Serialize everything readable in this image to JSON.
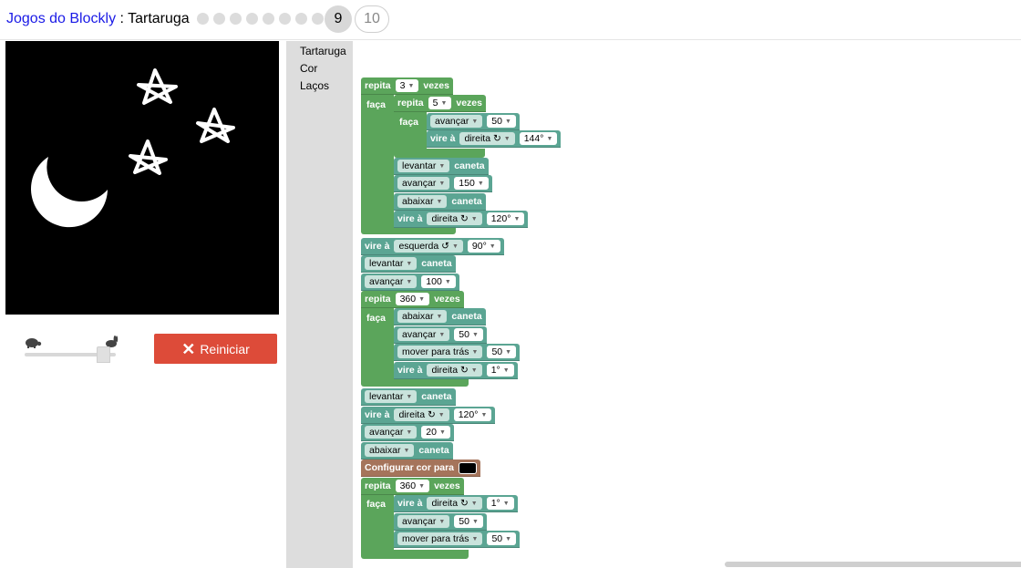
{
  "header": {
    "app_link": "Jogos do Blockly",
    "separator": " : ",
    "game_name": "Tartaruga",
    "current_level": "9",
    "next_level": "10",
    "completed_levels": 8
  },
  "controls": {
    "slow_icon": "turtle-icon",
    "fast_icon": "rabbit-icon",
    "speed_fraction": 0.93,
    "reset_label": "Reiniciar",
    "reset_color": "#dd4b39"
  },
  "toolbox": [
    "Tartaruga",
    "Cor",
    "Laços"
  ],
  "colors": {
    "loop": "#5ba55b",
    "turtle": "#5ba593",
    "color_block": "#a5745b",
    "toolbox_bg": "#dddddd",
    "canvas_bg": "#000000"
  },
  "blocks": {
    "repeat_kw": "repita",
    "times_kw": "vezes",
    "do_kw": "faça",
    "pen_kw": "caneta",
    "turn_kw": "vire à",
    "set_color": "Configurar cor para",
    "b1": {
      "count": "3"
    },
    "b2": {
      "count": "5"
    },
    "b3": {
      "move": "avançar",
      "amount": "50"
    },
    "b4": {
      "dir": "direita ↻",
      "angle": "144°"
    },
    "b5": {
      "pen": "levantar"
    },
    "b6": {
      "move": "avançar",
      "amount": "150"
    },
    "b7": {
      "pen": "abaixar"
    },
    "b8": {
      "dir": "direita ↻",
      "angle": "120°"
    },
    "b9": {
      "dir": "esquerda ↺",
      "angle": "90°"
    },
    "b10": {
      "pen": "levantar"
    },
    "b11": {
      "move": "avançar",
      "amount": "100"
    },
    "b12": {
      "count": "360"
    },
    "b13": {
      "pen": "abaixar"
    },
    "b14": {
      "move": "avançar",
      "amount": "50"
    },
    "b15": {
      "move": "mover para trás",
      "amount": "50"
    },
    "b16": {
      "dir": "direita ↻",
      "angle": "1°"
    },
    "b17": {
      "pen": "levantar"
    },
    "b18": {
      "dir": "direita ↻",
      "angle": "120°"
    },
    "b19": {
      "move": "avançar",
      "amount": "20"
    },
    "b20": {
      "pen": "abaixar"
    },
    "b21": {
      "color": "#000000"
    },
    "b22": {
      "count": "360"
    },
    "b23": {
      "dir": "direita ↻",
      "angle": "1°"
    },
    "b24": {
      "move": "avançar",
      "amount": "50"
    },
    "b25": {
      "move": "mover para trás",
      "amount": "50"
    }
  }
}
